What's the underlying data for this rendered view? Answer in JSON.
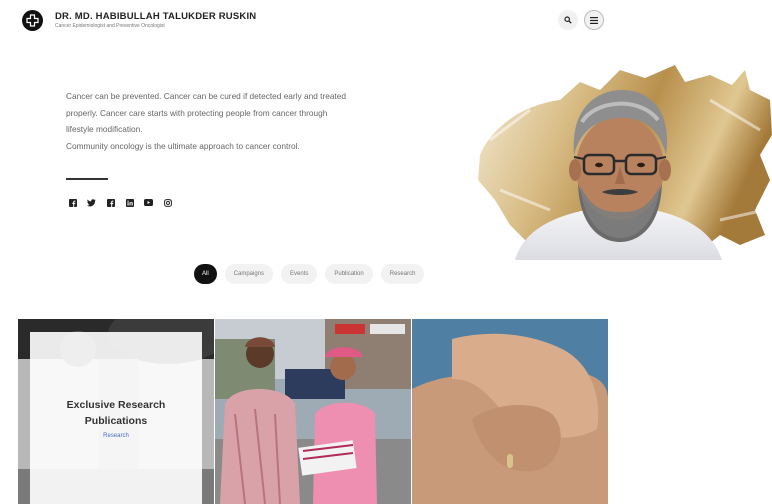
{
  "header": {
    "name": "DR. MD. HABIBULLAH TALUKDER RUSKIN",
    "subtitle": "Cancer Epidemiologist and Preventive Oncologist",
    "logo_icon": "cross-icon",
    "search_icon": "search-icon",
    "menu_icon": "hamburger-menu-icon"
  },
  "hero": {
    "lines": [
      "Cancer can be prevented. Cancer can be cured if detected early and treated",
      "properly. Cancer care starts with protecting people from cancer through",
      "lifestyle modification.",
      "Community oncology is the ultimate approach to cancer control."
    ],
    "socials": [
      "facebook-icon",
      "twitter-icon",
      "facebook-icon",
      "linkedin-icon",
      "youtube-icon",
      "instagram-icon"
    ]
  },
  "filters": [
    "All",
    "Campaigns",
    "Events",
    "Publication",
    "Research"
  ],
  "active_filter": "All",
  "gallery": {
    "card1": {
      "title": "Exclusive Research Publications",
      "tag": "Research"
    }
  },
  "colors": {
    "accent_gold": "#c9a96b",
    "primary_dark": "#111111",
    "tag_blue": "#4a6cc2"
  }
}
